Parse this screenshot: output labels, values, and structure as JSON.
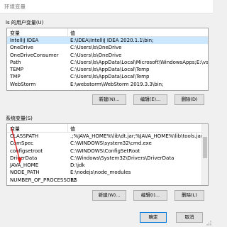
{
  "window": {
    "title": "环境变量"
  },
  "user_vars": {
    "label": "ls 的用户变量(U)",
    "header": {
      "var": "变量",
      "val": "值"
    },
    "rows": [
      {
        "var": "IntelliJ IDEA",
        "val": "E:\\IDEA\\IntelliJ IDEA 2020.1.1\\bin;",
        "selected": true
      },
      {
        "var": "OneDrive",
        "val": "C:\\Users\\ls\\OneDrive"
      },
      {
        "var": "OneDriveConsumer",
        "val": "C:\\Users\\ls\\OneDrive"
      },
      {
        "var": "Path",
        "val": "C:\\Users\\ls\\AppData\\Local\\Microsoft\\WindowsApps;E:\\vs co..."
      },
      {
        "var": "TEMP",
        "val": "C:\\Users\\ls\\AppData\\Local\\Temp"
      },
      {
        "var": "TMP",
        "val": "C:\\Users\\ls\\AppData\\Local\\Temp"
      },
      {
        "var": "WebStorm",
        "val": "E:\\webstorm\\WebStorm 2019.3.3\\bin;"
      }
    ],
    "buttons": {
      "new": "新建(N)...",
      "edit": "编辑(E)...",
      "delete": "删除(D)"
    }
  },
  "system_vars": {
    "label": "系统变量(S)",
    "header": {
      "var": "变量",
      "val": "值"
    },
    "rows": [
      {
        "var": "CLASSPATH",
        "val": ".;%JAVA_HOME%\\lib\\dt.jar;%JAVA_HOME%\\lib\\tools.jar;"
      },
      {
        "var": "ComSpec",
        "val": "C:\\WINDOWS\\system32\\cmd.exe"
      },
      {
        "var": "configsetroot",
        "val": "C:\\WINDOWS\\ConfigSetRoot"
      },
      {
        "var": "DriverData",
        "val": "C:\\Windows\\System32\\Drivers\\DriverData"
      },
      {
        "var": "JAVA_HOME",
        "val": "D:\\jdk"
      },
      {
        "var": "NODE_PATH",
        "val": "E:\\nodejs\\node_modules"
      },
      {
        "var": "NUMBER_OF_PROCESSORS",
        "val": "12"
      }
    ],
    "buttons": {
      "new": "新建(W)...",
      "edit": "编辑(I)...",
      "delete": "删除(L)"
    }
  },
  "footer": {
    "ok": "确定",
    "cancel": "取消"
  },
  "colors": {
    "selection": "#cce8ff",
    "annotation_arrow": "#e02020",
    "focus_border": "#0078d7"
  }
}
